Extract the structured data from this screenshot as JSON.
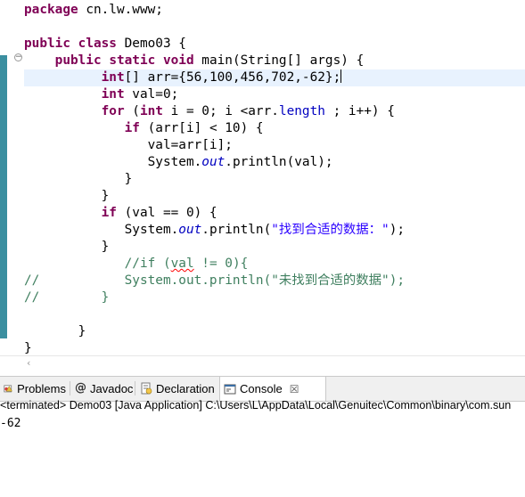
{
  "editor": {
    "lines": [
      {
        "id": "l1",
        "parts": [
          [
            "kw",
            "package"
          ],
          [
            "",
            " cn.lw.www;"
          ]
        ]
      },
      {
        "id": "l2",
        "parts": []
      },
      {
        "id": "l3",
        "parts": [
          [
            "kw",
            "public"
          ],
          [
            "",
            " "
          ],
          [
            "kw",
            "class"
          ],
          [
            "",
            " Demo03 {"
          ]
        ]
      },
      {
        "id": "l4",
        "parts": [
          [
            "",
            "    "
          ],
          [
            "kw",
            "public"
          ],
          [
            "",
            " "
          ],
          [
            "kw",
            "static"
          ],
          [
            "",
            " "
          ],
          [
            "kw",
            "void"
          ],
          [
            "",
            " main(String[] args) {"
          ]
        ]
      },
      {
        "id": "l5",
        "parts": [
          [
            "",
            "          "
          ],
          [
            "kw",
            "int"
          ],
          [
            "",
            "[] arr={56,100,456,702,-62};"
          ]
        ]
      },
      {
        "id": "l6",
        "parts": [
          [
            "",
            "          "
          ],
          [
            "kw",
            "int"
          ],
          [
            "",
            " val=0;"
          ]
        ]
      },
      {
        "id": "l7",
        "parts": [
          [
            "",
            "          "
          ],
          [
            "kw",
            "for"
          ],
          [
            "",
            " ("
          ],
          [
            "kw",
            "int"
          ],
          [
            "",
            " i = 0; i <arr."
          ],
          [
            "fld",
            "length"
          ],
          [
            "",
            " ; i++) {"
          ]
        ]
      },
      {
        "id": "l8",
        "parts": [
          [
            "",
            "             "
          ],
          [
            "kw",
            "if"
          ],
          [
            "",
            " (arr[i] < 10) {"
          ]
        ]
      },
      {
        "id": "l9",
        "parts": [
          [
            "",
            "                val=arr[i];"
          ]
        ]
      },
      {
        "id": "l10",
        "parts": [
          [
            "",
            "                System."
          ],
          [
            "sfld",
            "out"
          ],
          [
            "",
            ".println(val);"
          ]
        ]
      },
      {
        "id": "l11",
        "parts": [
          [
            "",
            "             }"
          ]
        ]
      },
      {
        "id": "l12",
        "parts": [
          [
            "",
            "          }"
          ]
        ]
      },
      {
        "id": "l13",
        "parts": [
          [
            "",
            "          "
          ],
          [
            "kw",
            "if"
          ],
          [
            "",
            " (val == 0) {"
          ]
        ]
      },
      {
        "id": "l14",
        "parts": [
          [
            "",
            "             System."
          ],
          [
            "sfld",
            "out"
          ],
          [
            "",
            ".println("
          ],
          [
            "str",
            "\"找到合适的数据：\""
          ],
          [
            "",
            ");"
          ]
        ]
      },
      {
        "id": "l15",
        "parts": [
          [
            "",
            "          }"
          ]
        ]
      },
      {
        "id": "l16",
        "parts": [
          [
            "",
            "             "
          ],
          [
            "cmt",
            "//if ("
          ],
          [
            "cmt squig",
            "val"
          ],
          [
            "cmt",
            " != 0){"
          ]
        ]
      },
      {
        "id": "l17",
        "parts": [
          [
            "cmt",
            "//           System.out.println(\"未找到合适的数据\");"
          ]
        ]
      },
      {
        "id": "l18",
        "parts": [
          [
            "cmt",
            "//        }"
          ]
        ]
      },
      {
        "id": "l19",
        "parts": []
      },
      {
        "id": "l20",
        "parts": [
          [
            "",
            "       }"
          ]
        ]
      },
      {
        "id": "l21",
        "parts": [
          [
            "",
            "}"
          ]
        ]
      }
    ]
  },
  "tabs": [
    {
      "id": "problems",
      "label": "Problems",
      "icon": "problems-icon"
    },
    {
      "id": "javadoc",
      "label": "Javadoc",
      "icon": "at-icon",
      "glyph": "@"
    },
    {
      "id": "declaration",
      "label": "Declaration",
      "icon": "declaration-icon"
    },
    {
      "id": "console",
      "label": "Console",
      "icon": "console-icon",
      "close": "☒"
    }
  ],
  "console": {
    "status": "<terminated> Demo03 [Java Application] C:\\Users\\L\\AppData\\Local\\Genuitec\\Common\\binary\\com.sun",
    "output": "-62"
  },
  "colors": {
    "keyword": "#7f0055",
    "string": "#2a00ff",
    "comment": "#3f7f5f",
    "field": "#0000c0",
    "current_line": "#e8f2fe"
  },
  "scroll_arrow": "‹"
}
